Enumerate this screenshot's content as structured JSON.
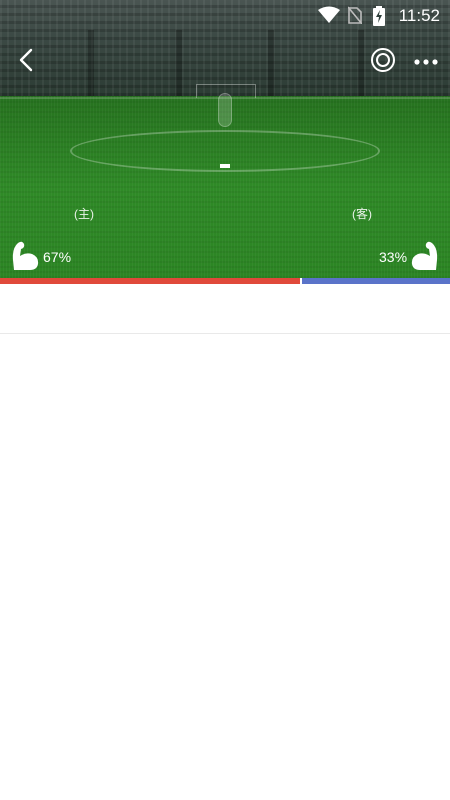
{
  "status_bar": {
    "time": "11:52",
    "icons": [
      "wifi-icon",
      "no-sim-icon",
      "battery-charging-icon"
    ]
  },
  "header": {
    "back_icon": "back-arrow-icon",
    "action_icon": "target-icon",
    "more_icon": "more-dots-icon"
  },
  "match": {
    "score_placeholder": "-",
    "home": {
      "label": "(主)",
      "strength_percent": "67%",
      "strength_fraction": 0.67,
      "icon": "flexed-arm-icon",
      "color": "#e0493a"
    },
    "away": {
      "label": "(客)",
      "strength_percent": "33%",
      "strength_fraction": 0.33,
      "icon": "flexed-arm-icon",
      "color": "#5a73c9"
    }
  }
}
